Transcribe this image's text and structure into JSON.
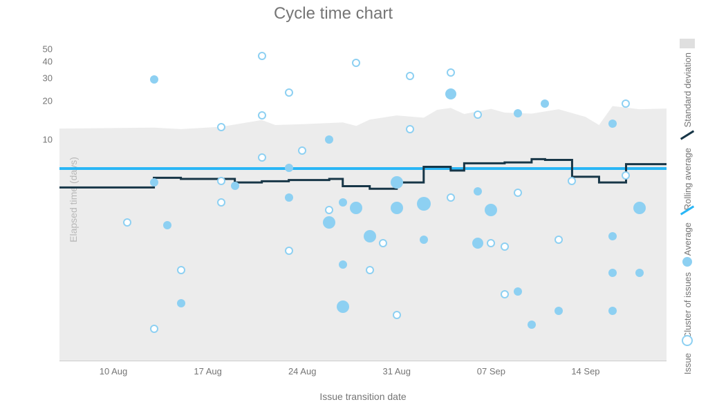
{
  "title": "Cycle time chart",
  "xlabel": "Issue transition date",
  "ylabel": "Elapsed time (days)",
  "colors": {
    "avg": "#29b6f6",
    "roll": "#173647",
    "cluster": "#8dd0f2",
    "issue_ring": "#8dd0f2",
    "band": "#e6e6e6"
  },
  "legend": {
    "std": "Standard deviation",
    "roll": "Rolling average",
    "avg": "Average",
    "cluster": "Cluster of issues",
    "issue": "Issue"
  },
  "chart_data": {
    "type": "scatter",
    "title": "Cycle time chart",
    "xlabel": "Issue transition date",
    "ylabel": "Elapsed time (days)",
    "x_range_days": [
      0,
      45
    ],
    "y_range": [
      0.2,
      60
    ],
    "y_scale": "log",
    "y_ticks": [
      10,
      20,
      30,
      40,
      50
    ],
    "x_ticks": [
      {
        "day": 4,
        "label": "10 Aug"
      },
      {
        "day": 11,
        "label": "17 Aug"
      },
      {
        "day": 18,
        "label": "24 Aug"
      },
      {
        "day": 25,
        "label": "31 Aug"
      },
      {
        "day": 32,
        "label": "07 Sep"
      },
      {
        "day": 39,
        "label": "14 Sep"
      }
    ],
    "average": 6.0,
    "rolling_average": [
      {
        "day": 0,
        "val": 4.3
      },
      {
        "day": 6,
        "val": 4.3
      },
      {
        "day": 7,
        "val": 5.1
      },
      {
        "day": 9,
        "val": 5.0
      },
      {
        "day": 13,
        "val": 4.7
      },
      {
        "day": 15,
        "val": 4.8
      },
      {
        "day": 17,
        "val": 4.9
      },
      {
        "day": 20,
        "val": 5.0
      },
      {
        "day": 21,
        "val": 4.4
      },
      {
        "day": 23,
        "val": 4.2
      },
      {
        "day": 25,
        "val": 4.7
      },
      {
        "day": 26,
        "val": 4.7
      },
      {
        "day": 27,
        "val": 6.2
      },
      {
        "day": 29,
        "val": 5.8
      },
      {
        "day": 30,
        "val": 6.6
      },
      {
        "day": 33,
        "val": 6.7
      },
      {
        "day": 35,
        "val": 7.1
      },
      {
        "day": 36,
        "val": 7.0
      },
      {
        "day": 38,
        "val": 5.2
      },
      {
        "day": 40,
        "val": 4.7
      },
      {
        "day": 42,
        "val": 6.5
      },
      {
        "day": 45,
        "val": 6.5
      }
    ],
    "std_band_upper": [
      {
        "day": 0,
        "val": 12.2
      },
      {
        "day": 7,
        "val": 12.4
      },
      {
        "day": 9,
        "val": 12.1
      },
      {
        "day": 12,
        "val": 12.6
      },
      {
        "day": 15,
        "val": 14.2
      },
      {
        "day": 16,
        "val": 13.0
      },
      {
        "day": 18,
        "val": 13.2
      },
      {
        "day": 21,
        "val": 13.6
      },
      {
        "day": 22,
        "val": 12.8
      },
      {
        "day": 23,
        "val": 14.3
      },
      {
        "day": 25,
        "val": 15.4
      },
      {
        "day": 27,
        "val": 14.8
      },
      {
        "day": 28,
        "val": 17.0
      },
      {
        "day": 29,
        "val": 17.6
      },
      {
        "day": 30,
        "val": 15.8
      },
      {
        "day": 32,
        "val": 17.3
      },
      {
        "day": 33,
        "val": 16.2
      },
      {
        "day": 35,
        "val": 15.9
      },
      {
        "day": 37,
        "val": 17.2
      },
      {
        "day": 39,
        "val": 15.0
      },
      {
        "day": 40,
        "val": 13.0
      },
      {
        "day": 41,
        "val": 18.2
      },
      {
        "day": 43,
        "val": 17.2
      },
      {
        "day": 45,
        "val": 17.4
      }
    ],
    "series": [
      {
        "name": "Cluster of issues",
        "kind": "cluster",
        "points": [
          {
            "day": 7,
            "val": 29,
            "size": 12
          },
          {
            "day": 7,
            "val": 4.7,
            "size": 12
          },
          {
            "day": 8,
            "val": 2.2,
            "size": 12
          },
          {
            "day": 9,
            "val": 0.55,
            "size": 12
          },
          {
            "day": 13,
            "val": 4.4,
            "size": 12
          },
          {
            "day": 17,
            "val": 6.1,
            "size": 12
          },
          {
            "day": 17,
            "val": 3.6,
            "size": 12
          },
          {
            "day": 20,
            "val": 10,
            "size": 12
          },
          {
            "day": 20,
            "val": 2.3,
            "size": 18
          },
          {
            "day": 21,
            "val": 0.52,
            "size": 18
          },
          {
            "day": 21,
            "val": 1.1,
            "size": 12
          },
          {
            "day": 21,
            "val": 3.3,
            "size": 12
          },
          {
            "day": 22,
            "val": 3.0,
            "size": 18
          },
          {
            "day": 23,
            "val": 1.8,
            "size": 18
          },
          {
            "day": 25,
            "val": 4.7,
            "size": 18
          },
          {
            "day": 25,
            "val": 3.0,
            "size": 18
          },
          {
            "day": 27,
            "val": 3.2,
            "size": 20
          },
          {
            "day": 27,
            "val": 1.7,
            "size": 12
          },
          {
            "day": 29,
            "val": 22.5,
            "size": 16
          },
          {
            "day": 31,
            "val": 1.6,
            "size": 16
          },
          {
            "day": 31,
            "val": 4.0,
            "size": 12
          },
          {
            "day": 32,
            "val": 2.9,
            "size": 18
          },
          {
            "day": 34,
            "val": 0.68,
            "size": 12
          },
          {
            "day": 34,
            "val": 16,
            "size": 12
          },
          {
            "day": 35,
            "val": 0.38,
            "size": 12
          },
          {
            "day": 36,
            "val": 19,
            "size": 12
          },
          {
            "day": 37,
            "val": 0.48,
            "size": 12
          },
          {
            "day": 41,
            "val": 13.3,
            "size": 12
          },
          {
            "day": 41,
            "val": 1.8,
            "size": 12
          },
          {
            "day": 41,
            "val": 0.95,
            "size": 12
          },
          {
            "day": 41,
            "val": 0.48,
            "size": 12
          },
          {
            "day": 43,
            "val": 3.0,
            "size": 18
          },
          {
            "day": 43,
            "val": 0.95,
            "size": 12
          }
        ]
      },
      {
        "name": "Issue",
        "kind": "issue",
        "points": [
          {
            "day": 5,
            "val": 2.3
          },
          {
            "day": 7,
            "val": 0.35
          },
          {
            "day": 9,
            "val": 1.0
          },
          {
            "day": 12,
            "val": 12.6
          },
          {
            "day": 12,
            "val": 4.8
          },
          {
            "day": 12,
            "val": 3.3
          },
          {
            "day": 15,
            "val": 44
          },
          {
            "day": 15,
            "val": 15.5
          },
          {
            "day": 15,
            "val": 7.3
          },
          {
            "day": 17,
            "val": 23
          },
          {
            "day": 17,
            "val": 1.4
          },
          {
            "day": 18,
            "val": 8.3
          },
          {
            "day": 20,
            "val": 2.9
          },
          {
            "day": 22,
            "val": 39
          },
          {
            "day": 23,
            "val": 1.0
          },
          {
            "day": 24,
            "val": 1.6
          },
          {
            "day": 25,
            "val": 0.45
          },
          {
            "day": 26,
            "val": 31
          },
          {
            "day": 26,
            "val": 12
          },
          {
            "day": 29,
            "val": 33
          },
          {
            "day": 29,
            "val": 3.6
          },
          {
            "day": 31,
            "val": 15.6
          },
          {
            "day": 32,
            "val": 1.6
          },
          {
            "day": 33,
            "val": 1.5
          },
          {
            "day": 33,
            "val": 0.65
          },
          {
            "day": 34,
            "val": 3.9
          },
          {
            "day": 37,
            "val": 1.7
          },
          {
            "day": 38,
            "val": 4.8
          },
          {
            "day": 42,
            "val": 19
          },
          {
            "day": 42,
            "val": 5.3
          }
        ]
      }
    ]
  }
}
